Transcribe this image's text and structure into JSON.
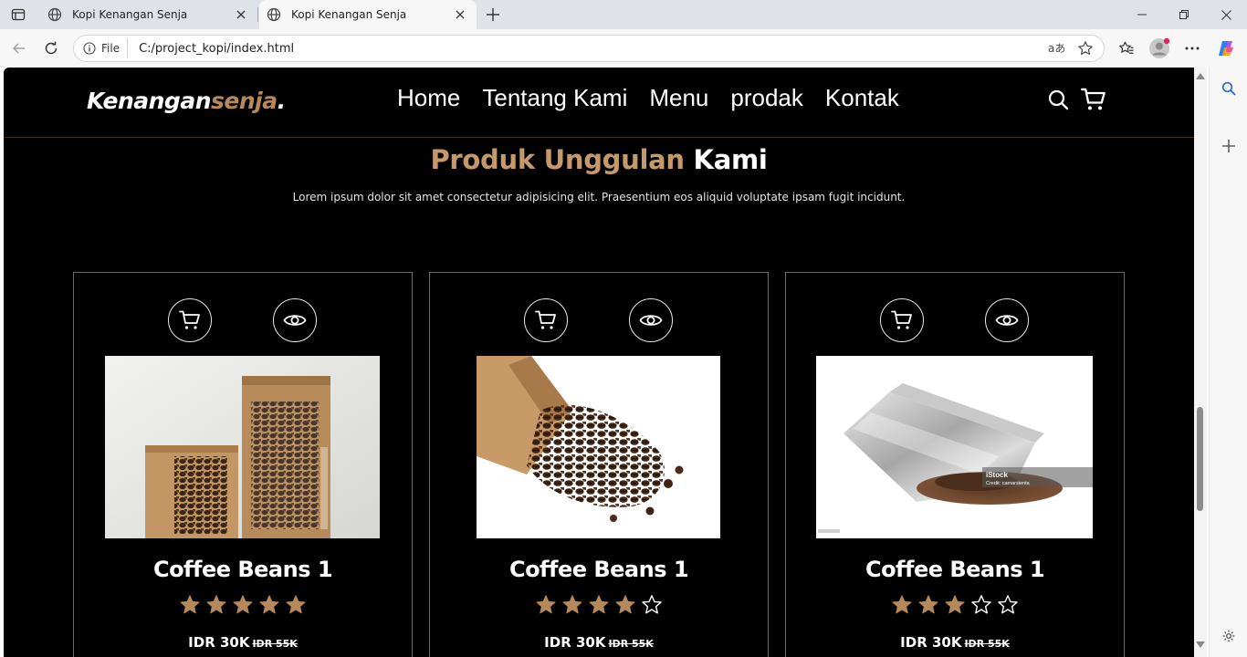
{
  "browser": {
    "tabs": [
      {
        "title": "Kopi Kenangan Senja",
        "active": false
      },
      {
        "title": "Kopi Kenangan Senja",
        "active": true
      }
    ],
    "site_info_label": "File",
    "url": "C:/project_kopi/index.html"
  },
  "site": {
    "logo_main": "Kenangan",
    "logo_accent": "senja",
    "logo_dot": ".",
    "nav": [
      "Home",
      "Tentang Kami",
      "Menu",
      "prodak",
      "Kontak"
    ],
    "section_title_accent": "Produk Unggulan",
    "section_title_rest": "Kami",
    "section_subtitle": "Lorem ipsum dolor sit amet consectetur adipisicing elit. Praesentium eos aliquid voluptate ipsam fugit incidunt.",
    "products": [
      {
        "name": "Coffee Beans 1",
        "rating": 5,
        "price": "IDR 30K",
        "old_price": "IDR 55K",
        "image": "kraft pouches with coffee beans"
      },
      {
        "name": "Coffee Beans 1",
        "rating": 4,
        "price": "IDR 30K",
        "old_price": "IDR 55K",
        "image": "paper bag with spilled coffee beans"
      },
      {
        "name": "Coffee Beans 1",
        "rating": 3,
        "price": "IDR 30K",
        "old_price": "IDR 55K",
        "image": "foil pouch with ground coffee"
      }
    ],
    "watermark": {
      "brand": "iStock",
      "credit": "Credit: camarsienta"
    }
  },
  "colors": {
    "accent": "#b6895b",
    "star": "#b6895b",
    "page_bg": "#010101"
  }
}
